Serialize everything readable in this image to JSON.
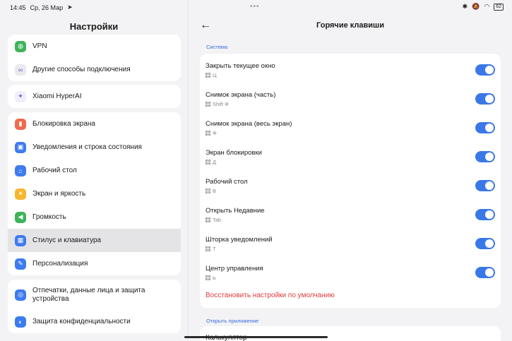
{
  "status": {
    "time": "14:45",
    "date": "Ср, 26 Мар",
    "dots": "•••",
    "battery": "62"
  },
  "left": {
    "title": "Настройки",
    "groups": [
      {
        "items": [
          {
            "label": "VPN",
            "icon": "globe-icon",
            "color": "#3fb35a"
          },
          {
            "label": "Другие способы подключения",
            "icon": "link-icon",
            "color": "#e9e9ee"
          }
        ]
      },
      {
        "items": [
          {
            "label": "Xiaomi HyperAI",
            "icon": "ai-icon",
            "color": "#f0eef8"
          }
        ]
      },
      {
        "items": [
          {
            "label": "Блокировка экрана",
            "icon": "lock-icon",
            "color": "#ef6b4c"
          },
          {
            "label": "Уведомления и строка состояния",
            "icon": "notification-icon",
            "color": "#3d7bf0"
          },
          {
            "label": "Рабочий стол",
            "icon": "home-icon",
            "color": "#3d7bf0"
          },
          {
            "label": "Экран и яркость",
            "icon": "sun-icon",
            "color": "#f5b52c"
          },
          {
            "label": "Громкость",
            "icon": "volume-icon",
            "color": "#3fb35a"
          },
          {
            "label": "Стилус и клавиатура",
            "icon": "keyboard-icon",
            "color": "#3d7bf0"
          },
          {
            "label": "Персонализация",
            "icon": "brush-icon",
            "color": "#3d7bf0"
          }
        ]
      },
      {
        "items": [
          {
            "label": "Отпечатки, данные лица и защита устройства",
            "icon": "fingerprint-icon",
            "color": "#3d7bf0"
          },
          {
            "label": "Защита конфиденциальности",
            "icon": "privacy-icon",
            "color": "#3d7bf0"
          }
        ]
      }
    ]
  },
  "right": {
    "title": "Горячие клавиши",
    "section1": "Система",
    "shortcuts": [
      {
        "title": "Закрыть текущее окно",
        "keys": "Ц"
      },
      {
        "title": "Снимок экрана (часть)",
        "keys": "Shift Ф"
      },
      {
        "title": "Снимок экрана (весь экран)",
        "keys": "Ф"
      },
      {
        "title": "Экран блокировки",
        "keys": "Д"
      },
      {
        "title": "Рабочий стол",
        "keys": "В"
      },
      {
        "title": "Открыть Недавние",
        "keys": "Tab"
      },
      {
        "title": "Шторка уведомлений",
        "keys": "Т"
      },
      {
        "title": "Центр управления",
        "keys": "Ь"
      }
    ],
    "restore": "Восстановить настройки по умолчанию",
    "section2": "Открыть приложение",
    "next_item": "Калькулятор"
  },
  "colors": {
    "accent": "#3a78e8",
    "danger": "#e0393a",
    "section": "#3b6ce0"
  }
}
